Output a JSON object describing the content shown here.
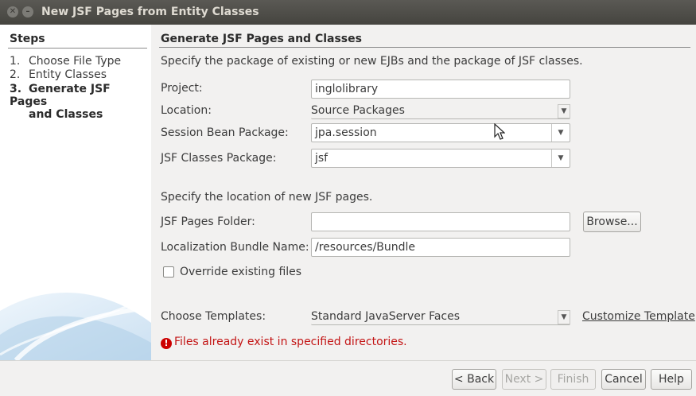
{
  "window": {
    "title": "New JSF Pages from Entity Classes",
    "close_glyph": "✕",
    "minimize_glyph": "–"
  },
  "steps": {
    "title": "Steps",
    "items": [
      {
        "num": "1.",
        "label": "Choose File Type"
      },
      {
        "num": "2.",
        "label": "Entity Classes"
      },
      {
        "num": "3.",
        "label": "Generate JSF Pages",
        "cont": "and Classes"
      }
    ]
  },
  "main": {
    "heading": "Generate JSF Pages and Classes",
    "description": "Specify the package of existing or new EJBs and the package of JSF classes.",
    "project": {
      "label": "Project:",
      "value": "inglolibrary"
    },
    "location": {
      "label": "Location:",
      "value": "Source Packages"
    },
    "session_bean": {
      "label": "Session Bean Package:",
      "value": "jpa.session"
    },
    "jsf_classes": {
      "label": "JSF Classes Package:",
      "value": "jsf"
    },
    "pages_description": "Specify the location of new JSF pages.",
    "pages_folder": {
      "label": "JSF Pages Folder:",
      "value": ""
    },
    "browse_label": "Browse...",
    "bundle": {
      "label": "Localization Bundle Name:",
      "value": "/resources/Bundle"
    },
    "override": {
      "label": "Override existing files",
      "checked": false
    },
    "templates": {
      "label": "Choose Templates:",
      "value": "Standard JavaServer Faces"
    },
    "customize_link": "Customize Template",
    "error": {
      "icon": "!",
      "text": "Files already exist in specified directories."
    }
  },
  "buttons": {
    "back": "< Back",
    "next": "Next >",
    "finish": "Finish",
    "cancel": "Cancel",
    "help": "Help"
  },
  "icons": {
    "dropdown_arrow": "▼"
  },
  "colors": {
    "error": "#c31414",
    "titlebar": "#45443f"
  }
}
